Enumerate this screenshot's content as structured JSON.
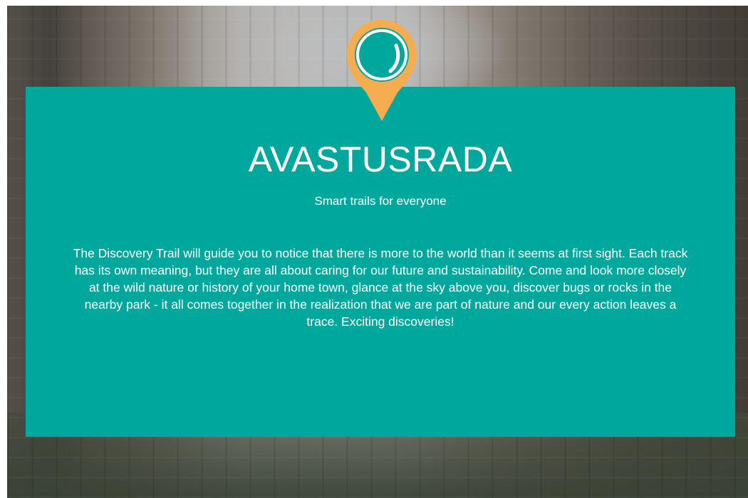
{
  "colors": {
    "card_background": "#00a79d",
    "pin_outline": "#f6ad4f",
    "text": "#ffffff"
  },
  "hero": {
    "background": "old-town-street-photo",
    "logo_icon": "map-pin-icon",
    "brand_name": "AVASTUSRADA",
    "tagline": "Smart trails for everyone",
    "description": "The Discovery Trail will guide you to notice that there is more to the world than it seems at first sight. Each track has its own meaning, but they are all about caring for our future and sustainability. Come and look more closely at the wild nature or history of your home town, glance at the sky above you, discover bugs or rocks in the nearby park - it all comes together in the realization that we are part of nature and our every action leaves a trace. Exciting discoveries!"
  }
}
